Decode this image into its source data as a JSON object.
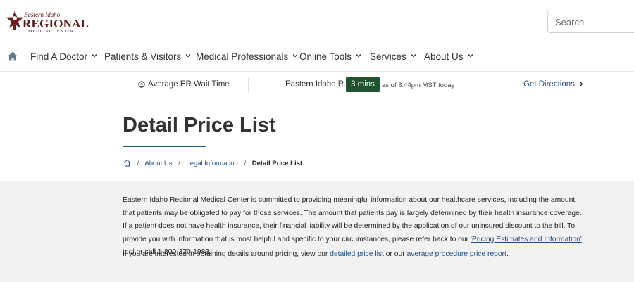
{
  "logo": {
    "line1": "Eastern Idaho",
    "line2": "REGIONAL",
    "line3": "MEDICAL CENTER"
  },
  "search": {
    "placeholder": "Search"
  },
  "nav": {
    "items": [
      {
        "label": "Find A Doctor"
      },
      {
        "label": "Patients & Visitors"
      },
      {
        "label": "Medical Professionals"
      },
      {
        "label": "Online Tools"
      },
      {
        "label": "Services"
      },
      {
        "label": "About Us"
      }
    ]
  },
  "er": {
    "label": "Average ER Wait Time",
    "hospital": "Eastern Idaho R...",
    "wait": "3 mins",
    "as_of": "as of 8:44pm MST today",
    "directions": "Get Directions"
  },
  "page": {
    "title": "Detail Price List"
  },
  "breadcrumb": {
    "items": [
      "About Us",
      "Legal Information"
    ],
    "current": "Detail Price List"
  },
  "content": {
    "p1_text": "Eastern Idaho Regional Medical Center is committed to providing meaningful information about our healthcare services, including the amount that patients may be obligated to pay for those services. The amount that patients pay is largely determined by their health insurance coverage. If a patient does not have health insurance, their financial liability will be determined by the application of our uninsured discount to the bill. To provide you with information that is most helpful and specific to your circumstances, please refer back to our ",
    "p1_link": "'Pricing Estimates and Information' tool",
    "p1_tail": " or call 1-800-370-1983.",
    "p2_text": "If you are interested in obtaining details around pricing, view our ",
    "p2_link1": "detailed price list",
    "p2_mid": " or our ",
    "p2_link2": "average procedure price report",
    "p2_tail": "."
  },
  "colors": {
    "brand": "#5a1a1a",
    "link": "#1f4c82",
    "badge": "#20522f",
    "accent_rule": "#1e5f7c"
  }
}
